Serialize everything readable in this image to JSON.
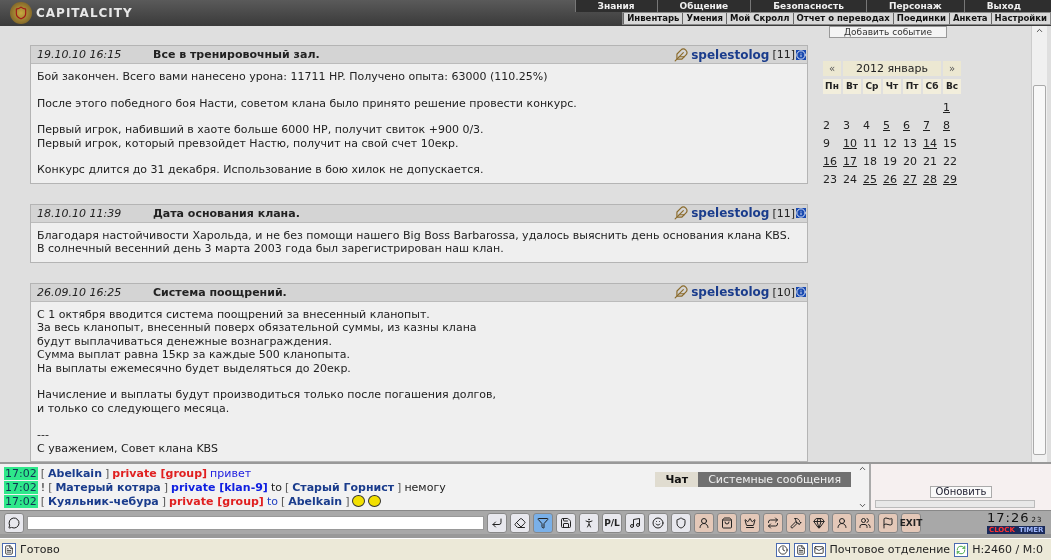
{
  "header": {
    "logo_text": "CAPITALCITY",
    "menu": [
      "Знания",
      "Общение",
      "Безопасность",
      "Персонаж",
      "Выход"
    ],
    "submenu": [
      "Инвентарь",
      "Умения",
      "Мой Скролл",
      "Отчет о переводах",
      "Поединки",
      "Анкета",
      "Настройки"
    ]
  },
  "posts": [
    {
      "date": "19.10.10 16:15",
      "title": "Все в тренировочный зал.",
      "author": "spelestolog",
      "level": "[11]",
      "paragraphs": [
        [
          "Бой закончен. Всего вами нанесено урона: 11711 HP. Получено опыта: 63000 (110.25%)"
        ],
        [
          "После этого победного боя Насти, советом клана было принято решение провести конкурс."
        ],
        [
          "Первый игрок, набивший в хаоте больше 6000 HP, получит свиток +900 0/3.",
          "Первый игрок, который превзойдет Настю, получит на свой счет 10екр."
        ],
        [
          "Конкурс длится до 31 декабря. Использование в бою хилок не допускается."
        ]
      ]
    },
    {
      "date": "18.10.10 11:39",
      "title": "Дата основания клана.",
      "author": "spelestolog",
      "level": "[11]",
      "paragraphs": [
        [
          "Благодаря настойчивости Харольда, и не без помощи нашего Big Boss Barbarossa, удалось выяснить день основания клана KBS.",
          "В солнечный весенний день 3 марта 2003 года был зарегистрирован наш клан."
        ]
      ]
    },
    {
      "date": "26.09.10 16:25",
      "title": "Система поощрений.",
      "author": "spelestolog",
      "level": "[10]",
      "paragraphs": [
        [
          "С 1 октября вводится система поощрений за внесенный кланопыт.",
          "За весь кланопыт, внесенный поверх обязательной суммы, из казны клана",
          "будут выплачиваться денежные вознаграждения.",
          "Сумма выплат равна 15кр за каждые 500 кланопыта.",
          "На выплаты ежемесячно будет выделяться до 20екр."
        ],
        [
          "Начисление и выплаты будут производиться только после погашения долгов,",
          "и только со следующего месяца."
        ],
        [
          "---",
          "С уважением, Совет клана KBS"
        ]
      ]
    }
  ],
  "calendar": {
    "add_event": "Добавить событие",
    "prev": "«",
    "title": "2012 январь",
    "next": "»",
    "weekdays": [
      "Пн",
      "Вт",
      "Ср",
      "Чт",
      "Пт",
      "Сб",
      "Вс"
    ],
    "weeks": [
      {
        "kind": "partial",
        "days": [
          {
            "day": "1",
            "link": true
          }
        ]
      },
      {
        "kind": "full",
        "days": [
          {
            "day": "2",
            "link": false
          },
          {
            "day": "3",
            "link": false
          },
          {
            "day": "4",
            "link": false
          },
          {
            "day": "5",
            "link": true
          },
          {
            "day": "6",
            "link": true
          },
          {
            "day": "7",
            "link": true
          },
          {
            "day": "8",
            "link": true
          }
        ]
      },
      {
        "kind": "full",
        "days": [
          {
            "day": "9",
            "link": false
          },
          {
            "day": "10",
            "link": true
          },
          {
            "day": "11",
            "link": false
          },
          {
            "day": "12",
            "link": false
          },
          {
            "day": "13",
            "link": false
          },
          {
            "day": "14",
            "link": true
          },
          {
            "day": "15",
            "link": false
          }
        ]
      },
      {
        "kind": "full",
        "days": [
          {
            "day": "16",
            "link": true
          },
          {
            "day": "17",
            "link": true
          },
          {
            "day": "18",
            "link": false
          },
          {
            "day": "19",
            "link": false
          },
          {
            "day": "20",
            "link": false
          },
          {
            "day": "21",
            "link": false
          },
          {
            "day": "22",
            "link": false
          }
        ]
      },
      {
        "kind": "full",
        "days": [
          {
            "day": "23",
            "link": false
          },
          {
            "day": "24",
            "link": false
          },
          {
            "day": "25",
            "link": true
          },
          {
            "day": "26",
            "link": true
          },
          {
            "day": "27",
            "link": true
          },
          {
            "day": "28",
            "link": true
          },
          {
            "day": "29",
            "link": true
          }
        ]
      }
    ]
  },
  "chat": {
    "messages": [
      [
        {
          "kind": "time",
          "text": "17:02"
        },
        {
          "kind": "bracket",
          "text": "["
        },
        {
          "kind": "name",
          "text": "Abelkain"
        },
        {
          "kind": "bracket",
          "text": "]"
        },
        {
          "kind": "private",
          "text": "private [group]"
        },
        {
          "kind": "msg",
          "text": "привет"
        }
      ],
      [
        {
          "kind": "time",
          "text": "17:02"
        },
        {
          "kind": "plain",
          "text": "!"
        },
        {
          "kind": "bracket",
          "text": "["
        },
        {
          "kind": "name",
          "text": "Матерый котяра"
        },
        {
          "kind": "bracket",
          "text": "]"
        },
        {
          "kind": "klan",
          "text": "private [klan-9]"
        },
        {
          "kind": "plain",
          "text": "to"
        },
        {
          "kind": "bracket",
          "text": "["
        },
        {
          "kind": "name",
          "text": "Старый Горнист"
        },
        {
          "kind": "bracket",
          "text": "]"
        },
        {
          "kind": "plain",
          "text": "немогу"
        }
      ],
      [
        {
          "kind": "time",
          "text": "17:02"
        },
        {
          "kind": "bracket",
          "text": "["
        },
        {
          "kind": "name",
          "text": "Куяльник-чебура"
        },
        {
          "kind": "bracket",
          "text": "]"
        },
        {
          "kind": "private",
          "text": "private [group]"
        },
        {
          "kind": "to",
          "text": "to"
        },
        {
          "kind": "bracket",
          "text": "["
        },
        {
          "kind": "name",
          "text": "Abelkain"
        },
        {
          "kind": "bracket",
          "text": "]"
        },
        {
          "kind": "emoji"
        }
      ]
    ],
    "tabs": [
      {
        "label": "Чат",
        "selected": true
      },
      {
        "label": "Системные сообщения",
        "selected": false
      }
    ],
    "refresh": "Обновить"
  },
  "toolbar": {
    "filter_selected": true,
    "pl_label": "P/L",
    "exit_label": "EXIT",
    "clock": "17:26",
    "seconds": "23",
    "clock_label": "CLOCK",
    "timer_label": "TIMER"
  },
  "status": {
    "text": "Готово",
    "mail": "Почтовое отделение",
    "counter": "H:2460 / M:0"
  }
}
